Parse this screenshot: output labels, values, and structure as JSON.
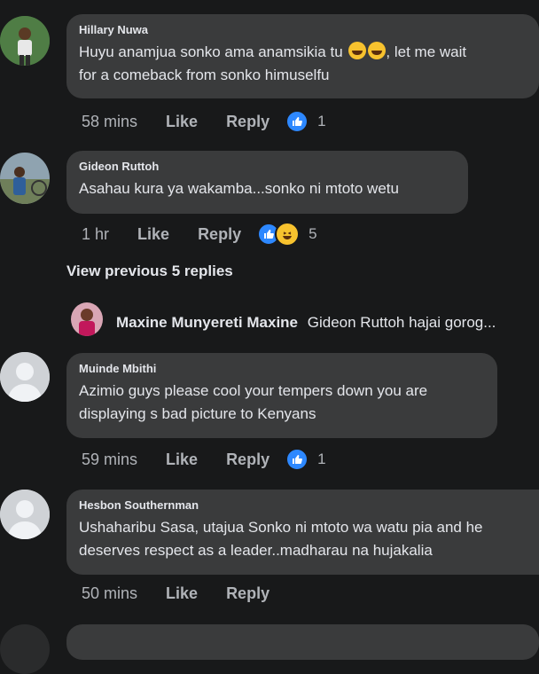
{
  "comments": [
    {
      "author": "Hillary Nuwa",
      "line1": "Huyu anamjua sonko ama anamsikia tu",
      "line1_tail": ", let me wait",
      "line2": "for a comeback from sonko himuselfu",
      "time": "58 mins",
      "like": "Like",
      "reply": "Reply",
      "reaction_count": "1"
    },
    {
      "author": "Gideon Ruttoh",
      "line1": "Asahau kura ya wakamba...sonko ni mtoto wetu",
      "time": "1 hr",
      "like": "Like",
      "reply": "Reply",
      "reaction_count": "5"
    },
    {
      "author": "Muinde Mbithi",
      "line1": "Azimio guys please cool your tempers down you are",
      "line2": "displaying s bad picture to  Kenyans",
      "time": "59 mins",
      "like": "Like",
      "reply": "Reply",
      "reaction_count": "1"
    },
    {
      "author": "Hesbon Southernman",
      "line1": "Ushaharibu Sasa, utajua Sonko ni mtoto wa watu pia and he",
      "line2": "deserves respect as a leader..madharau na hujakalia",
      "time": "50 mins",
      "like": "Like",
      "reply": "Reply"
    }
  ],
  "view_previous": "View previous 5 replies",
  "reply_preview": {
    "author": "Maxine Munyereti Maxine",
    "text": "Gideon Ruttoh hajai gorog..."
  },
  "colors": {
    "background": "#18191a",
    "bubble": "#3a3b3c",
    "like_blue": "#2d88ff",
    "haha_yellow": "#f7c22e"
  }
}
